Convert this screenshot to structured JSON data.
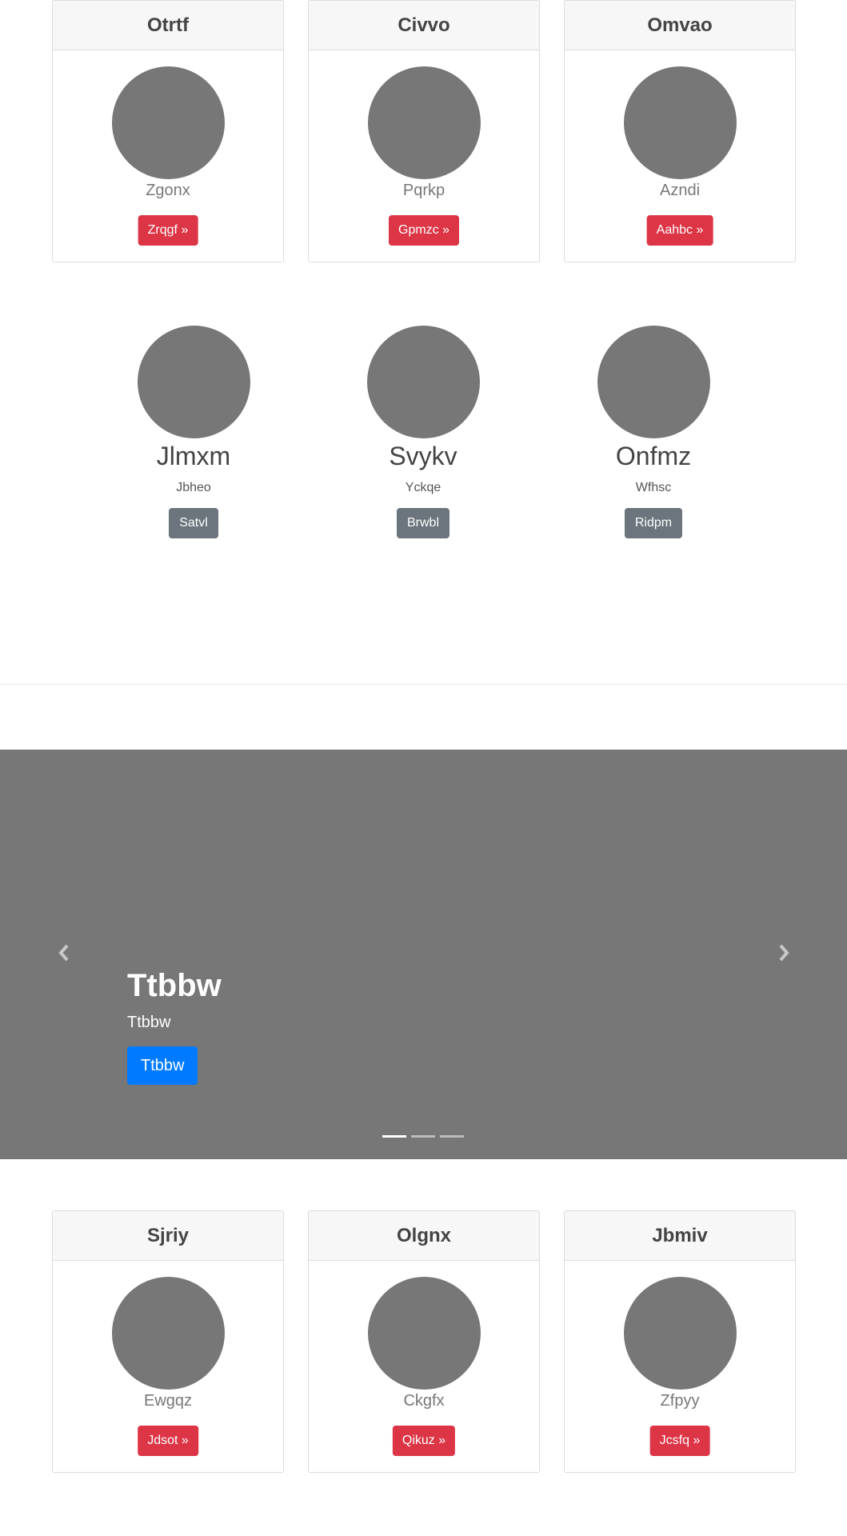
{
  "top_cards": [
    {
      "title": "Otrtf",
      "subtitle": "Zgonx",
      "button": "Zrqgf »"
    },
    {
      "title": "Civvo",
      "subtitle": "Pqrkp",
      "button": "Gpmzc »"
    },
    {
      "title": "Omvao",
      "subtitle": "Azndi",
      "button": "Aahbc »"
    }
  ],
  "features": [
    {
      "title": "Jlmxm",
      "subtitle": "Jbheo",
      "button": "Satvl"
    },
    {
      "title": "Svykv",
      "subtitle": "Yckqe",
      "button": "Brwbl"
    },
    {
      "title": "Onfmz",
      "subtitle": "Wfhsc",
      "button": "Ridpm"
    }
  ],
  "carousel": {
    "heading": "Ttbbw",
    "text": "Ttbbw",
    "button": "Ttbbw",
    "slide_count": 3,
    "active_slide": 1
  },
  "bottom_cards": [
    {
      "title": "Sjriy",
      "subtitle": "Ewgqz",
      "button": "Jdsot »"
    },
    {
      "title": "Olgnx",
      "subtitle": "Ckgfx",
      "button": "Qikuz »"
    },
    {
      "title": "Jbmiv",
      "subtitle": "Zfpyy",
      "button": "Jcsfq »"
    }
  ],
  "colors": {
    "placeholder": "#777777",
    "danger": "#dc3545",
    "secondary": "#6c757d",
    "primary": "#007bff"
  },
  "icons": {
    "carousel_prev": "chevron-left-icon",
    "carousel_next": "chevron-right-icon"
  }
}
